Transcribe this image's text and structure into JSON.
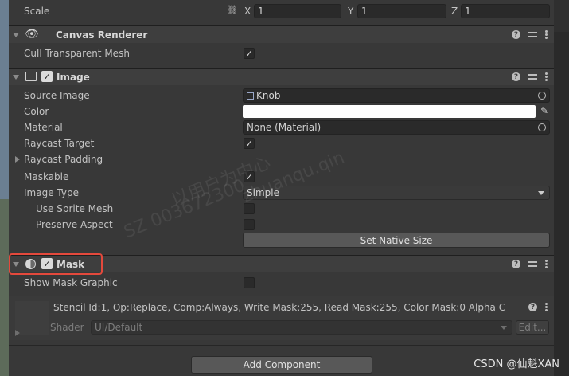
{
  "transform": {
    "scale_label": "Scale",
    "x_label": "X",
    "x_value": "1",
    "y_label": "Y",
    "y_value": "1",
    "z_label": "Z",
    "z_value": "1"
  },
  "canvas_renderer": {
    "title": "Canvas Renderer",
    "cull_label": "Cull Transparent Mesh",
    "cull_checked": "✓"
  },
  "image": {
    "title": "Image",
    "enabled_check": "✓",
    "source_image_label": "Source Image",
    "source_image_value": "Knob",
    "color_label": "Color",
    "material_label": "Material",
    "material_value": "None (Material)",
    "raycast_target_label": "Raycast Target",
    "raycast_target_check": "✓",
    "raycast_padding_label": "Raycast Padding",
    "maskable_label": "Maskable",
    "maskable_check": "✓",
    "image_type_label": "Image Type",
    "image_type_value": "Simple",
    "use_sprite_mesh_label": "Use Sprite Mesh",
    "preserve_aspect_label": "Preserve Aspect",
    "set_native_size_label": "Set Native Size"
  },
  "mask": {
    "title": "Mask",
    "enabled_check": "✓",
    "show_graphic_label": "Show Mask Graphic"
  },
  "material_preview": {
    "stencil_text": "Stencil Id:1, Op:Replace, Comp:Always, Write Mask:255, Read Mask:255, Color Mask:0 Alpha C",
    "shader_label": "Shader",
    "shader_value": "UI/Default",
    "edit_label": "Edit..."
  },
  "add_component_label": "Add Component",
  "watermark": {
    "line1": "以用户为中心",
    "line2": "zhuanqu.qin",
    "line3": "SZ 003672300"
  },
  "footer_credit": "CSDN @仙魁XAN",
  "colors": {
    "highlight": "#e4493c",
    "background": "#383838",
    "header": "#3e3e3e"
  }
}
